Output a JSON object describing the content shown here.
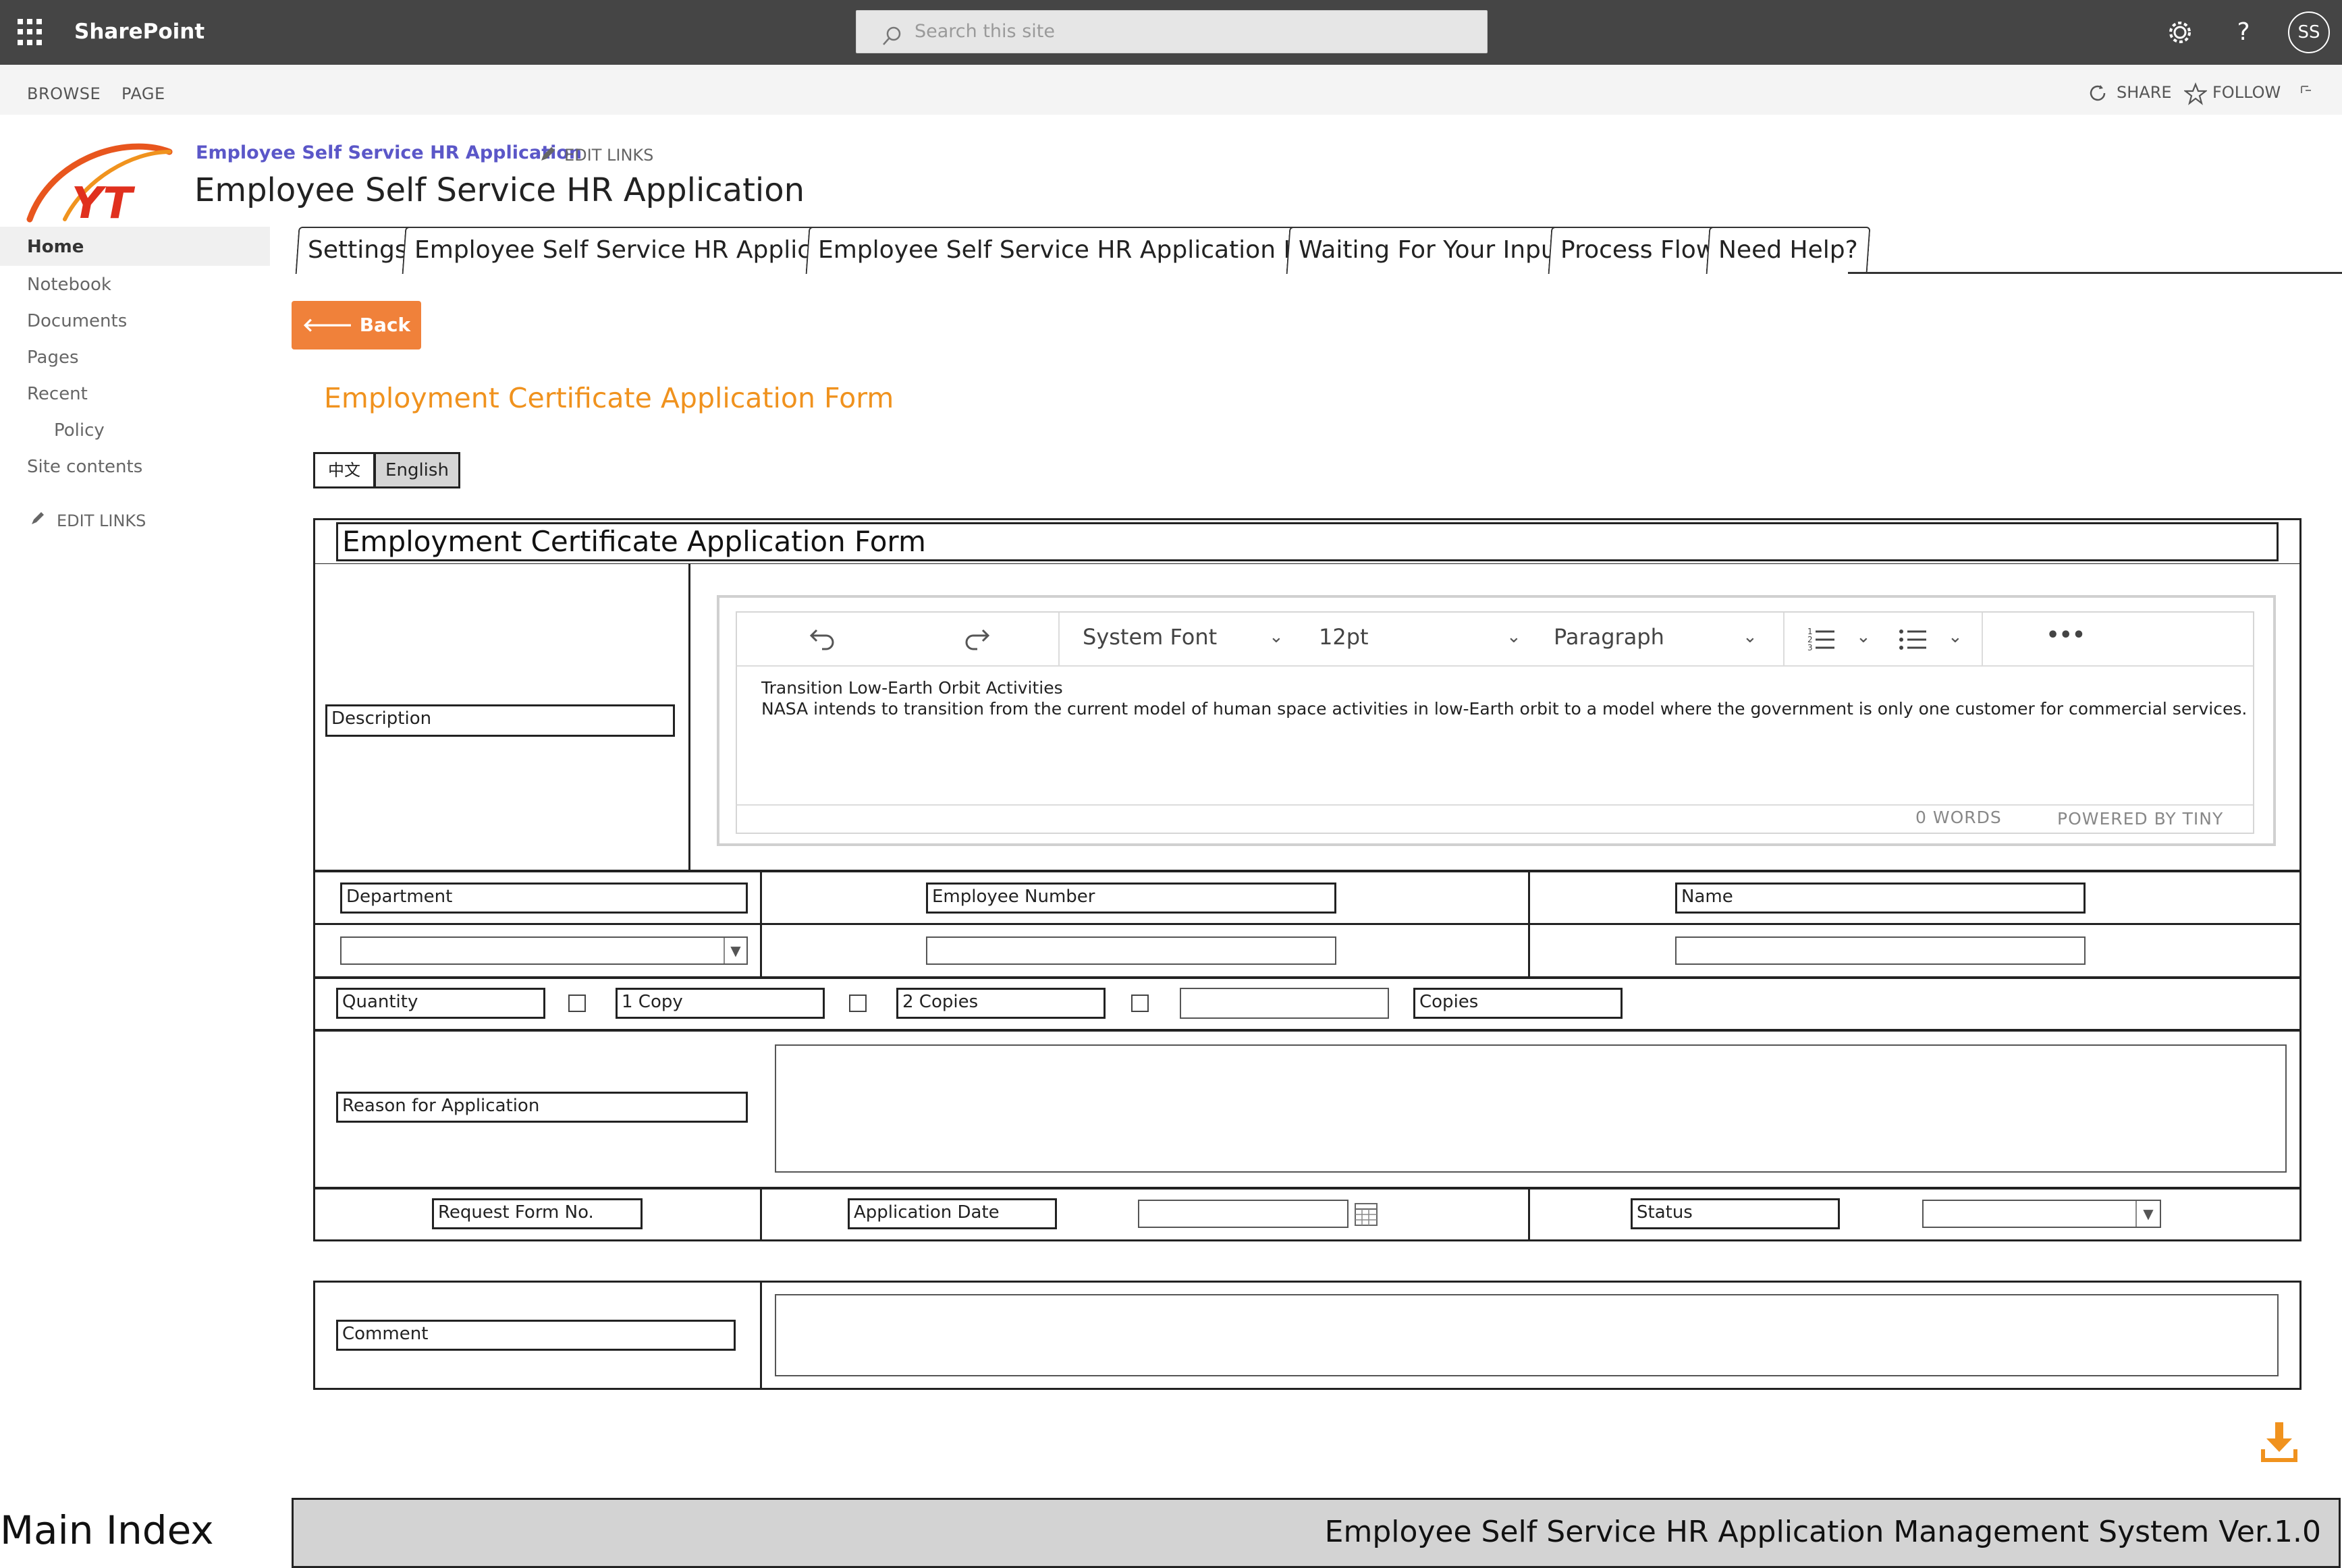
{
  "suite_bar": {
    "brand": "SharePoint",
    "search_placeholder": "Search this site",
    "help_icon_text": "?",
    "avatar_initials": "SS"
  },
  "ribbon": {
    "tabs": [
      "BROWSE",
      "PAGE"
    ],
    "share_label": "SHARE",
    "follow_label": "FOLLOW"
  },
  "site": {
    "breadcrumb_link": "Employee Self Service HR Application",
    "edit_links": "EDIT LINKS",
    "title": "Employee Self Service HR Application"
  },
  "nav": {
    "items": [
      "Home",
      "Notebook",
      "Documents",
      "Pages",
      "Recent",
      "Policy",
      "Site contents"
    ],
    "edit_links": "EDIT LINKS"
  },
  "tabs": [
    "Settings",
    "Employee Self Service HR Application",
    "Employee Self Service HR Application History",
    "Waiting For Your Input",
    "Process Flow",
    "Need Help?"
  ],
  "back_button": "Back",
  "form_heading": "Employment Certificate Application Form",
  "language": {
    "zh": "中文",
    "en": "English"
  },
  "form": {
    "title": "Employment Certificate Application Form",
    "description_label": "Description",
    "editor": {
      "font": "System Font",
      "size": "12pt",
      "block": "Paragraph",
      "more": "•••",
      "content_line1": "Transition Low-Earth Orbit Activities",
      "content_line2": "NASA intends to transition from the current model of human space activities in low-Earth orbit to a model where the government is only one customer for commercial services.",
      "word_count": "0 WORDS",
      "powered_by": "POWERED BY TINY"
    },
    "department_label": "Department",
    "employee_number_label": "Employee Number",
    "name_label": "Name",
    "quantity_label": "Quantity",
    "option_1_copy": "1 Copy",
    "option_2_copies": "2 Copies",
    "copies_label": "Copies",
    "reason_label": "Reason for Application",
    "request_form_no_label": "Request Form No.",
    "application_date_label": "Application Date",
    "status_label": "Status",
    "comment_label": "Comment"
  },
  "footer": {
    "main_index": "Main Index",
    "system_name": "Employee Self Service HR Application Management System Ver.1.0"
  },
  "colors": {
    "suite_bar": "#454545",
    "accent_orange": "#f0813a",
    "heading_orange": "#f0921e",
    "link_purple": "#5b57c8"
  }
}
